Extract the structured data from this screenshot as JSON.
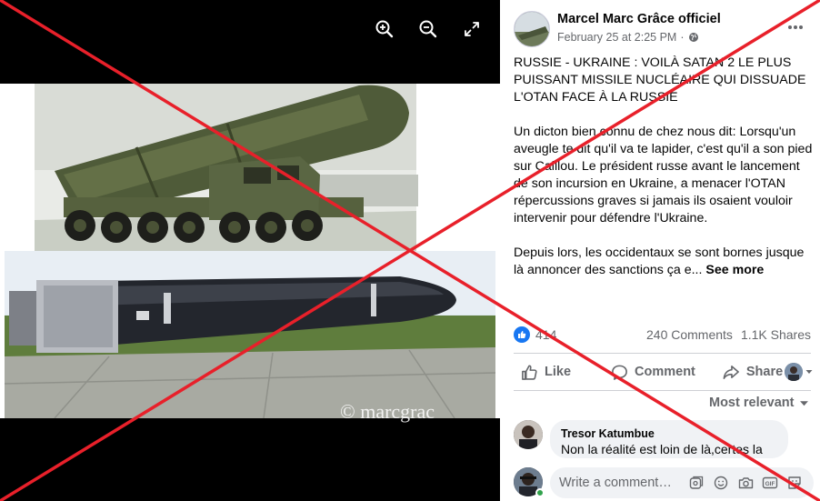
{
  "viewer": {
    "zoom_in_icon": "zoom-in-icon",
    "zoom_out_icon": "zoom-out-icon",
    "fullscreen_icon": "fullscreen-icon",
    "watermark": "© marcgrac"
  },
  "post": {
    "author": "Marcel Marc Grâce officiel",
    "date": "February 25 at 2:25 PM",
    "separator": "·",
    "audience_icon": "globe-icon",
    "more_icon": "more-horizontal-icon",
    "paragraphs": [
      "RUSSIE - UKRAINE : VOILÀ SATAN 2 LE PLUS PUISSANT MISSILE NUCLÉAIRE QUI DISSUADE L'OTAN FACE À LA RUSSIE",
      "Un dicton bien connu de chez nous dit: Lorsqu'un aveugle te dit qu'il va te lapider, c'est qu'il a son pied sur Caillou. Le président russe avant le lancement de son incursion en Ukraine, a menacer l'OTAN répercussions graves si jamais ils osaient vouloir intervenir pour défendre l'Ukraine.",
      "Depuis lors, les occidentaux se sont bornes jusque là annoncer des sanctions ça e..."
    ],
    "see_more": "See more"
  },
  "stats": {
    "reaction_count": "414",
    "comments": "240 Comments",
    "shares": "1.1K Shares"
  },
  "actions": {
    "like": "Like",
    "comment": "Comment",
    "share": "Share"
  },
  "comments_sort": "Most relevant",
  "comment": {
    "author": "Tresor Katumbue",
    "text": "Non la réalité est loin de là,certes la"
  },
  "composer": {
    "placeholder": "Write a comment…",
    "gif_label": "GIF"
  },
  "colors": {
    "accent": "#1877f2",
    "cross": "#e8202a",
    "online": "#31a24c"
  }
}
